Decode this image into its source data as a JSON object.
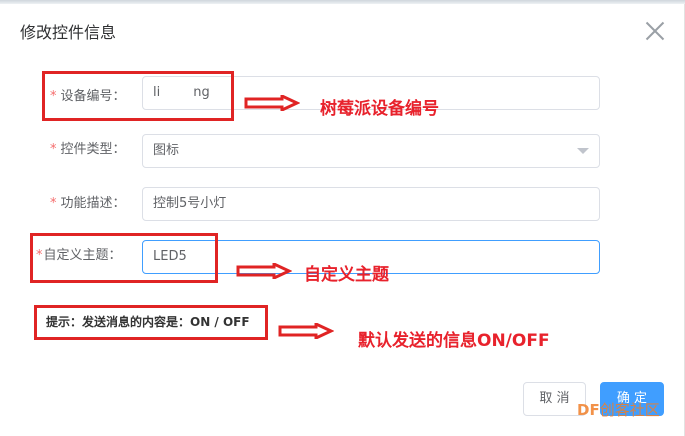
{
  "dialog": {
    "title": "修改控件信息",
    "close_icon": "close-icon"
  },
  "form": {
    "device_id": {
      "required_mark": "*",
      "label": "设备编号：",
      "value": "li        ng"
    },
    "control_type": {
      "required_mark": "*",
      "label": "控件类型：",
      "value": "图标",
      "icon": "chevron-down-icon"
    },
    "description": {
      "required_mark": "*",
      "label": "功能描述：",
      "value": "控制5号小灯"
    },
    "topic": {
      "required_mark": "*",
      "label": "自定义主题：",
      "value": "LED5"
    },
    "hint": "提示：发送消息的内容是：ON / OFF"
  },
  "annotations": {
    "device_id": "树莓派设备编号",
    "topic": "自定义主题",
    "hint": "默认发送的信息ON/OFF",
    "color": "#e02424"
  },
  "footer": {
    "cancel_label": "取 消",
    "ok_label": "确 定"
  },
  "watermark": {
    "brand": "DF",
    "text": "创客社区"
  },
  "colors": {
    "primary": "#409eff",
    "required": "#f56c6c",
    "annotation": "#e8222c"
  }
}
